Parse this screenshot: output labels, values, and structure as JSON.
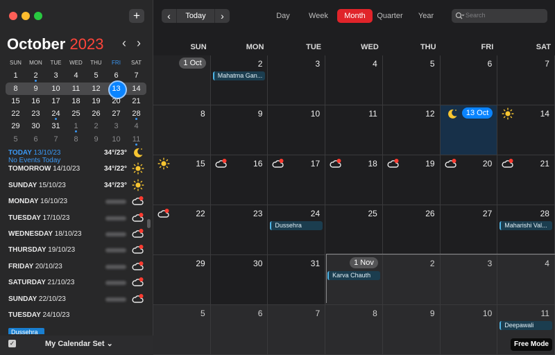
{
  "window": {
    "add_label": "+"
  },
  "mini": {
    "month": "October",
    "year": "2023",
    "prev": "‹",
    "next": "›",
    "weekdays": [
      "SUN",
      "MON",
      "TUE",
      "WED",
      "THU",
      "FRI",
      "SAT"
    ],
    "weeks": [
      [
        {
          "d": "1"
        },
        {
          "d": "2",
          "dot": true
        },
        {
          "d": "3"
        },
        {
          "d": "4"
        },
        {
          "d": "5"
        },
        {
          "d": "6"
        },
        {
          "d": "7"
        }
      ],
      [
        {
          "d": "8"
        },
        {
          "d": "9"
        },
        {
          "d": "10"
        },
        {
          "d": "11"
        },
        {
          "d": "12"
        },
        {
          "d": "13",
          "sel": true
        },
        {
          "d": "14"
        }
      ],
      [
        {
          "d": "15"
        },
        {
          "d": "16"
        },
        {
          "d": "17"
        },
        {
          "d": "18"
        },
        {
          "d": "19"
        },
        {
          "d": "20"
        },
        {
          "d": "21"
        }
      ],
      [
        {
          "d": "22"
        },
        {
          "d": "23"
        },
        {
          "d": "24",
          "dot": true
        },
        {
          "d": "25"
        },
        {
          "d": "26"
        },
        {
          "d": "27"
        },
        {
          "d": "28",
          "dot": true
        }
      ],
      [
        {
          "d": "29"
        },
        {
          "d": "30"
        },
        {
          "d": "31"
        },
        {
          "d": "1",
          "dim": true,
          "dot": true
        },
        {
          "d": "2",
          "dim": true
        },
        {
          "d": "3",
          "dim": true
        },
        {
          "d": "4",
          "dim": true
        }
      ],
      [
        {
          "d": "5",
          "dim": true
        },
        {
          "d": "6",
          "dim": true
        },
        {
          "d": "7",
          "dim": true
        },
        {
          "d": "8",
          "dim": true
        },
        {
          "d": "9",
          "dim": true
        },
        {
          "d": "10",
          "dim": true
        },
        {
          "d": "11",
          "dim": true,
          "dot": true
        }
      ]
    ]
  },
  "agenda": [
    {
      "name": "TODAY",
      "date": "13/10/23",
      "sub": "No Events Today",
      "temp": "34°/23°",
      "icon": "moon-icon",
      "today": true
    },
    {
      "name": "TOMORROW",
      "date": "14/10/23",
      "temp": "34°/22°",
      "icon": "sun-icon"
    },
    {
      "name": "SUNDAY",
      "date": "15/10/23",
      "temp": "34°/23°",
      "icon": "sun-icon"
    },
    {
      "name": "MONDAY",
      "date": "16/10/23",
      "icon": "storm-cloud-icon"
    },
    {
      "name": "TUESDAY",
      "date": "17/10/23",
      "icon": "storm-cloud-icon"
    },
    {
      "name": "WEDNESDAY",
      "date": "18/10/23",
      "icon": "storm-cloud-icon"
    },
    {
      "name": "THURSDAY",
      "date": "19/10/23",
      "icon": "storm-cloud-icon"
    },
    {
      "name": "FRIDAY",
      "date": "20/10/23",
      "icon": "storm-cloud-icon"
    },
    {
      "name": "SATURDAY",
      "date": "21/10/23",
      "icon": "storm-cloud-icon"
    },
    {
      "name": "SUNDAY",
      "date": "22/10/23",
      "icon": "storm-cloud-icon"
    },
    {
      "name": "TUESDAY",
      "date": "24/10/23"
    }
  ],
  "agenda_event": "Dussehra",
  "footer": {
    "calendar_set": "My Calendar Set ⌄"
  },
  "toolbar": {
    "prev": "‹",
    "today": "Today",
    "next": "›",
    "tabs": {
      "day": "Day",
      "week": "Week",
      "month": "Month",
      "quarter": "Quarter",
      "year": "Year"
    },
    "search_placeholder": "Search"
  },
  "grid": {
    "weekdays": [
      "SUN",
      "MON",
      "TUE",
      "WED",
      "THU",
      "FRI",
      "SAT"
    ],
    "weeks": [
      [
        {
          "n": "1 Oct",
          "pill": true
        },
        {
          "n": "2",
          "ev": "Mahatma Gan..."
        },
        {
          "n": "3"
        },
        {
          "n": "4"
        },
        {
          "n": "5"
        },
        {
          "n": "6"
        },
        {
          "n": "7"
        }
      ],
      [
        {
          "n": "8"
        },
        {
          "n": "9"
        },
        {
          "n": "10"
        },
        {
          "n": "11"
        },
        {
          "n": "12"
        },
        {
          "n": "13 Oct",
          "pill": true,
          "today": true,
          "icon": "moon-icon"
        },
        {
          "n": "14",
          "icon": "sun-icon"
        }
      ],
      [
        {
          "n": "15",
          "icon": "sun-icon"
        },
        {
          "n": "16",
          "icon": "storm-cloud-icon"
        },
        {
          "n": "17",
          "icon": "storm-cloud-icon"
        },
        {
          "n": "18",
          "icon": "storm-cloud-icon"
        },
        {
          "n": "19",
          "icon": "storm-cloud-icon"
        },
        {
          "n": "20",
          "icon": "storm-cloud-icon"
        },
        {
          "n": "21",
          "icon": "storm-cloud-icon"
        }
      ],
      [
        {
          "n": "22",
          "icon": "storm-cloud-icon"
        },
        {
          "n": "23"
        },
        {
          "n": "24",
          "ev": "Dussehra"
        },
        {
          "n": "25"
        },
        {
          "n": "26"
        },
        {
          "n": "27"
        },
        {
          "n": "28",
          "ev": "Maharishi Val..."
        }
      ],
      [
        {
          "n": "29"
        },
        {
          "n": "30"
        },
        {
          "n": "31"
        },
        {
          "n": "1 Nov",
          "pill": true,
          "ev": "Karva Chauth"
        },
        {
          "n": "2"
        },
        {
          "n": "3"
        },
        {
          "n": "4"
        }
      ],
      [
        {
          "n": "5"
        },
        {
          "n": "6"
        },
        {
          "n": "7"
        },
        {
          "n": "8"
        },
        {
          "n": "9"
        },
        {
          "n": "10"
        },
        {
          "n": "11",
          "ev": "Deepawali"
        }
      ]
    ]
  },
  "free_mode": "Free Mode"
}
